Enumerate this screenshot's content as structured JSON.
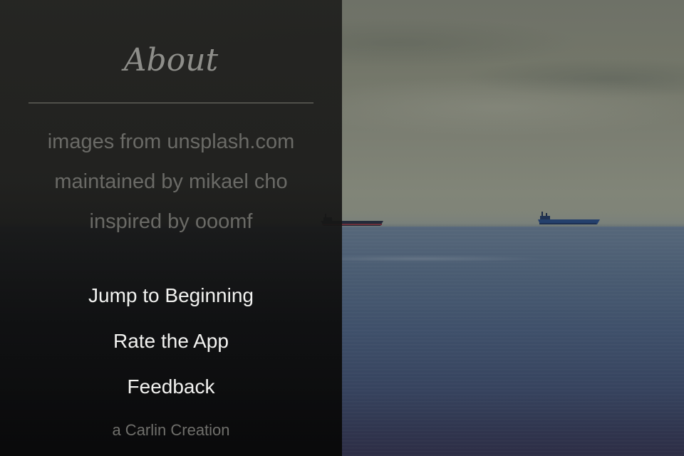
{
  "about": {
    "title": "About",
    "credits": [
      "images from unsplash.com",
      "maintained by mikael cho",
      "inspired by ooomf"
    ],
    "actions": {
      "jump_to_beginning": "Jump to Beginning",
      "rate_the_app": "Rate the App",
      "feedback": "Feedback"
    },
    "signature": "a Carlin Creation"
  },
  "colors": {
    "panel_background": "#1c1c1b",
    "title_text": "#8e8e8a",
    "credit_text": "#6a6a66",
    "action_text": "#f2f2f0",
    "sea": "#3f506a",
    "sky": "#7b7e72"
  }
}
